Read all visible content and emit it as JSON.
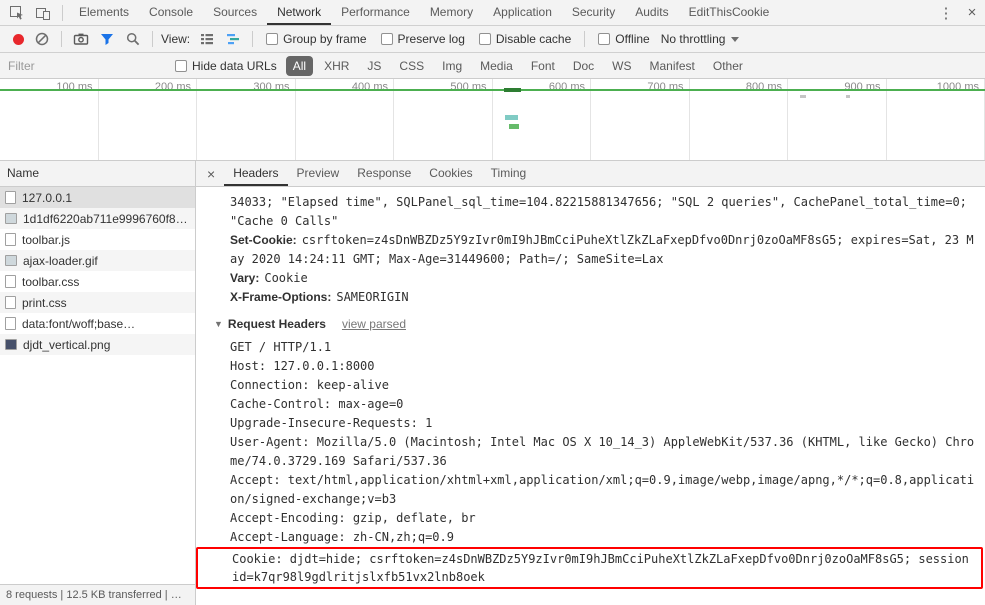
{
  "colors": {
    "accent_blue": "#1a73e8",
    "record_red": "#e8272c",
    "highlight_red": "#ff0000",
    "overview_green": "#4caf50",
    "selected_pill_bg": "#666666"
  },
  "main_tabs": {
    "items": [
      "Elements",
      "Console",
      "Sources",
      "Network",
      "Performance",
      "Memory",
      "Application",
      "Security",
      "Audits",
      "EditThisCookie"
    ],
    "selected": "Network",
    "menu_glyph": "⋮",
    "close_glyph": "×"
  },
  "network_toolbar": {
    "view_label": "View:",
    "group_by_frame": "Group by frame",
    "preserve_log": "Preserve log",
    "disable_cache": "Disable cache",
    "offline": "Offline",
    "throttling": "No throttling"
  },
  "filter_bar": {
    "placeholder": "Filter",
    "hide_data_urls": "Hide data URLs",
    "pills": [
      "All",
      "XHR",
      "JS",
      "CSS",
      "Img",
      "Media",
      "Font",
      "Doc",
      "WS",
      "Manifest",
      "Other"
    ],
    "selected_pill": "All"
  },
  "timeline": {
    "ticks": [
      "100 ms",
      "200 ms",
      "300 ms",
      "400 ms",
      "500 ms",
      "600 ms",
      "700 ms",
      "800 ms",
      "900 ms",
      "1000 ms"
    ]
  },
  "requests": {
    "column_header": "Name",
    "rows": [
      {
        "name": "127.0.0.1",
        "icon": "document-icon"
      },
      {
        "name": "1d1df6220ab711e9996760f8…",
        "icon": "image-icon"
      },
      {
        "name": "toolbar.js",
        "icon": "script-icon"
      },
      {
        "name": "ajax-loader.gif",
        "icon": "image-icon"
      },
      {
        "name": "toolbar.css",
        "icon": "stylesheet-icon"
      },
      {
        "name": "print.css",
        "icon": "stylesheet-icon"
      },
      {
        "name": "data:font/woff;base…",
        "icon": "font-icon"
      },
      {
        "name": "djdt_vertical.png",
        "icon": "image-icon"
      }
    ]
  },
  "detail_tabs": {
    "close_glyph": "×",
    "items": [
      "Headers",
      "Preview",
      "Response",
      "Cookies",
      "Timing"
    ],
    "selected": "Headers"
  },
  "headers_pane": {
    "overflow_value": "34033; \"Elapsed time\", SQLPanel_sql_time=104.82215881347656; \"SQL 2 queries\", CachePanel_total_time=0; \"Cache 0 Calls\"",
    "response_headers": [
      {
        "name": "Set-Cookie:",
        "value": "csrftoken=z4sDnWBZDz5Y9zIvr0mI9hJBmCciPuheXtlZkZLaFxepDfvo0Dnrj0zoOaMF8sG5; expires=Sat, 23 May 2020 14:24:11 GMT; Max-Age=31449600; Path=/; SameSite=Lax"
      },
      {
        "name": "Vary:",
        "value": "Cookie"
      },
      {
        "name": "X-Frame-Options:",
        "value": "SAMEORIGIN"
      }
    ],
    "request_headers_title": "Request Headers",
    "view_parsed_link": "view parsed",
    "raw_request_lines": [
      "GET / HTTP/1.1",
      "Host: 127.0.0.1:8000",
      "Connection: keep-alive",
      "Cache-Control: max-age=0",
      "Upgrade-Insecure-Requests: 1",
      "User-Agent: Mozilla/5.0 (Macintosh; Intel Mac OS X 10_14_3) AppleWebKit/537.36 (KHTML, like Gecko) Chrome/74.0.3729.169 Safari/537.36",
      "Accept: text/html,application/xhtml+xml,application/xml;q=0.9,image/webp,image/apng,*/*;q=0.8,application/signed-exchange;v=b3",
      "Accept-Encoding: gzip, deflate, br",
      "Accept-Language: zh-CN,zh;q=0.9"
    ],
    "cookie_line": "Cookie: djdt=hide; csrftoken=z4sDnWBZDz5Y9zIvr0mI9hJBmCciPuheXtlZkZLaFxepDfvo0Dnrj0zoOaMF8sG5; sessionid=k7qr98l9gdlritjslxfb51vx2lnb8oek"
  },
  "status_bar": {
    "text": "8 requests | 12.5 KB transferred | …"
  }
}
